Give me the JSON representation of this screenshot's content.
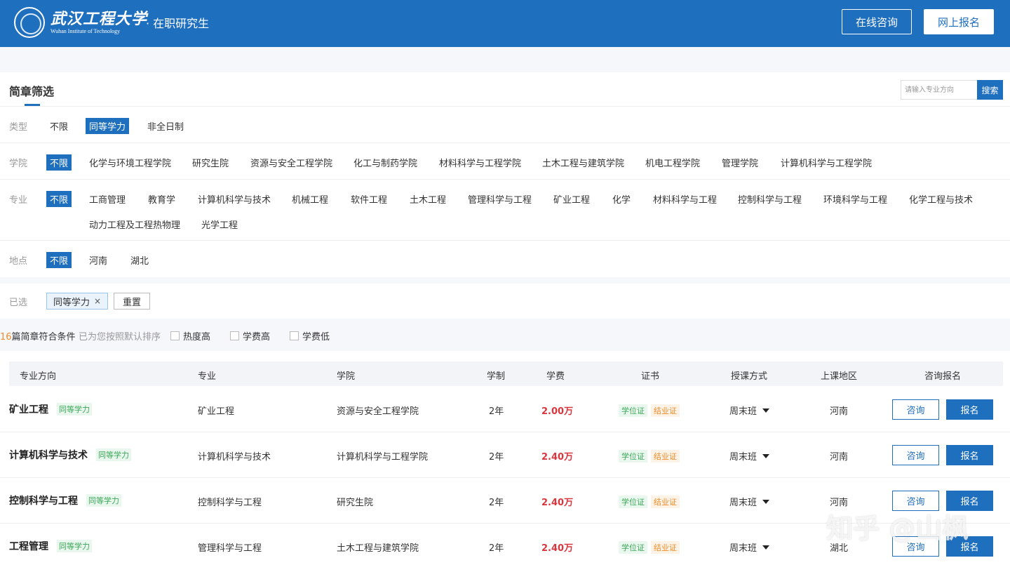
{
  "header": {
    "logo_cn": "武汉工程大学",
    "logo_en": "Wuhan Institute of Technology",
    "subtitle": "· 在职研究生",
    "consult_label": "在线咨询",
    "signup_label": "网上报名"
  },
  "filter": {
    "title": "简章筛选",
    "search_placeholder": "请输入专业方向",
    "search_label": "搜索",
    "type": {
      "label": "类型",
      "options": [
        "不限",
        "同等学力",
        "非全日制"
      ],
      "active": "同等学力"
    },
    "college": {
      "label": "学院",
      "options": [
        "不限",
        "化学与环境工程学院",
        "研究生院",
        "资源与安全工程学院",
        "化工与制药学院",
        "材料科学与工程学院",
        "土木工程与建筑学院",
        "机电工程学院",
        "管理学院",
        "计算机科学与工程学院"
      ],
      "active": "不限"
    },
    "major": {
      "label": "专业",
      "options": [
        "不限",
        "工商管理",
        "教育学",
        "计算机科学与技术",
        "机械工程",
        "软件工程",
        "土木工程",
        "管理科学与工程",
        "矿业工程",
        "化学",
        "材料科学与工程",
        "控制科学与工程",
        "环境科学与工程",
        "化学工程与技术",
        "动力工程及工程热物理",
        "光学工程"
      ],
      "active": "不限"
    },
    "location": {
      "label": "地点",
      "options": [
        "不限",
        "河南",
        "湖北"
      ],
      "active": "不限"
    }
  },
  "selected": {
    "label": "已选",
    "chip": "同等学力",
    "remove": "×",
    "reset_label": "重置"
  },
  "sort": {
    "count": "16",
    "count_suffix": "篇简章符合条件",
    "hint": "已为您按照默认排序",
    "options": [
      "热度高",
      "学费高",
      "学费低"
    ]
  },
  "table": {
    "headers": [
      "专业方向",
      "专业",
      "学院",
      "学制",
      "学费",
      "证书",
      "授课方式",
      "上课地区",
      "咨询报名"
    ],
    "rows": [
      {
        "direction": "矿业工程",
        "tag": "同等学力",
        "major": "矿业工程",
        "college": "资源与安全工程学院",
        "duration": "2年",
        "fee": "2.00万",
        "cert1": "学位证",
        "cert2": "结业证",
        "mode": "周末班",
        "region": "河南",
        "consult": "咨询",
        "signup": "报名"
      },
      {
        "direction": "计算机科学与技术",
        "tag": "同等学力",
        "major": "计算机科学与技术",
        "college": "计算机科学与工程学院",
        "duration": "2年",
        "fee": "2.40万",
        "cert1": "学位证",
        "cert2": "结业证",
        "mode": "周末班",
        "region": "河南",
        "consult": "咨询",
        "signup": "报名"
      },
      {
        "direction": "控制科学与工程",
        "tag": "同等学力",
        "major": "控制科学与工程",
        "college": "研究生院",
        "duration": "2年",
        "fee": "2.40万",
        "cert1": "学位证",
        "cert2": "结业证",
        "mode": "周末班",
        "region": "河南",
        "consult": "咨询",
        "signup": "报名"
      },
      {
        "direction": "工程管理",
        "tag": "同等学力",
        "major": "管理科学与工程",
        "college": "土木工程与建筑学院",
        "duration": "2年",
        "fee": "2.40万",
        "cert1": "学位证",
        "cert2": "结业证",
        "mode": "周末班",
        "region": "湖北",
        "consult": "咨询",
        "signup": "报名"
      }
    ]
  },
  "watermark": "知乎 @山枫",
  "colors": {
    "brand": "#1f6fbf",
    "fee": "#d9363e",
    "tag_green": "#3aa757",
    "tag_orange": "#f08c2a"
  }
}
